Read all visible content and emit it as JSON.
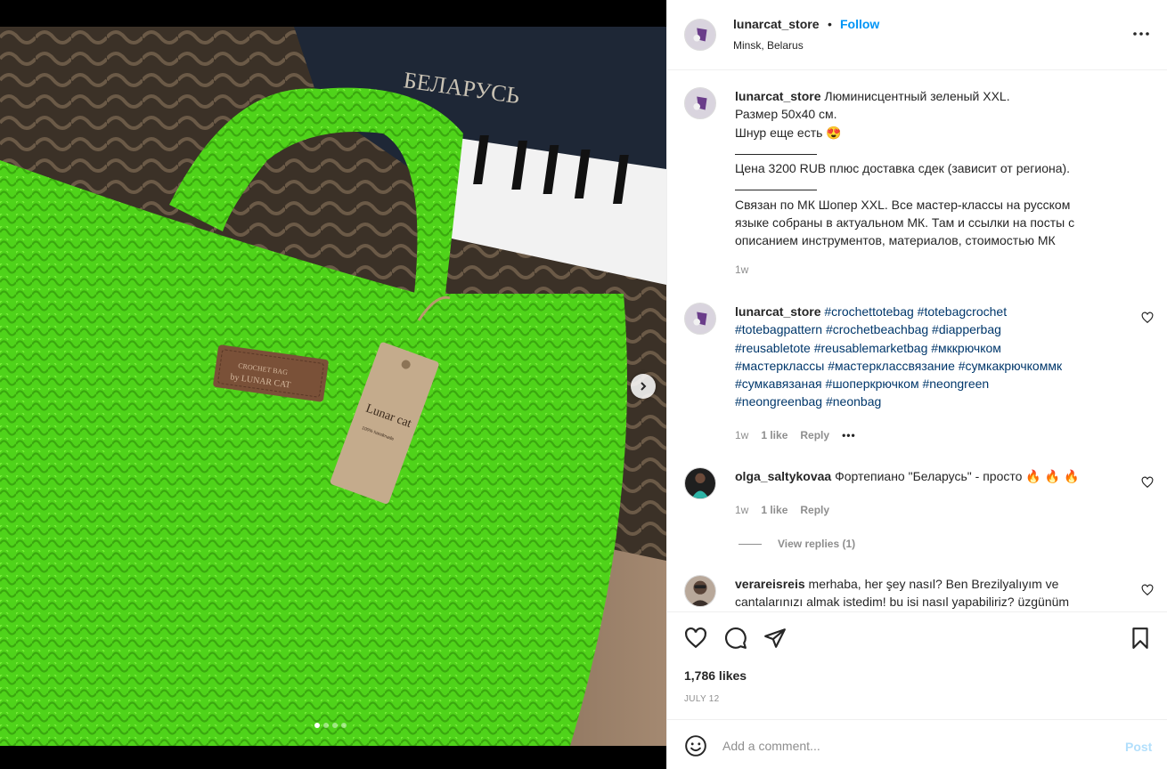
{
  "post": {
    "username": "lunarcat_store",
    "bullet": "•",
    "follow_label": "Follow",
    "location": "Minsk, Belarus",
    "more_icon": "more-horizontal-icon",
    "next_icon": "chevron-right-icon",
    "carousel_dots": 4,
    "carousel_active": 0
  },
  "caption": {
    "username": "lunarcat_store",
    "lines": [
      "Люминисцентный зеленый XXL.",
      "Размер 50х40 см.",
      "Шнур еще есть 😍",
      "Цена 3200 RUB плюс доставка сдек (зависит от региона).",
      "Связан по МК Шопер XXL. Все мастер-классы на русском",
      "языке собраны в актуальном МК. Там и ссылки на посты с",
      "описанием инструментов, материалов, стоимостью МК"
    ],
    "time": "1w"
  },
  "comments": [
    {
      "username": "lunarcat_store",
      "hashtag_lines": [
        "#crochettotebag #totebagcrochet",
        "#totebagpattern #crochetbeachbag #diapperbag",
        "#reusabletote #reusablemarketbag #мккрючком",
        "#мастерклассы #мастерклассвязание #сумкакрючкоммк",
        "#сумкавязаная #шоперкрючком #neongreen",
        "#neongreenbag #neonbag"
      ],
      "time": "1w",
      "likes": "1 like",
      "reply": "Reply",
      "options": "•••"
    },
    {
      "username": "olga_saltykovaa",
      "text": "Фортепиано \"Беларусь\" - просто 🔥 🔥 🔥",
      "time": "1w",
      "likes": "1 like",
      "reply": "Reply",
      "view_replies": "View replies (1)"
    },
    {
      "username": "verareisreis",
      "text_line1": "merhaba, her şey nasıl? Ben Brezilyalıyım ve",
      "text_line2": "cantalarınızı almak istedim! bu isi nasıl yapabiliriz? üzgünüm"
    }
  ],
  "actions": {
    "likes": "1,786 likes",
    "date": "JULY 12",
    "icons": [
      "heart-icon",
      "comment-icon",
      "share-icon",
      "bookmark-icon"
    ]
  },
  "add_comment": {
    "placeholder": "Add a comment...",
    "post_label": "Post"
  },
  "colors": {
    "accent": "#0095f6",
    "hashtag": "#00376b",
    "muted": "#8e8e8e",
    "bag_green": "#5be01e"
  }
}
